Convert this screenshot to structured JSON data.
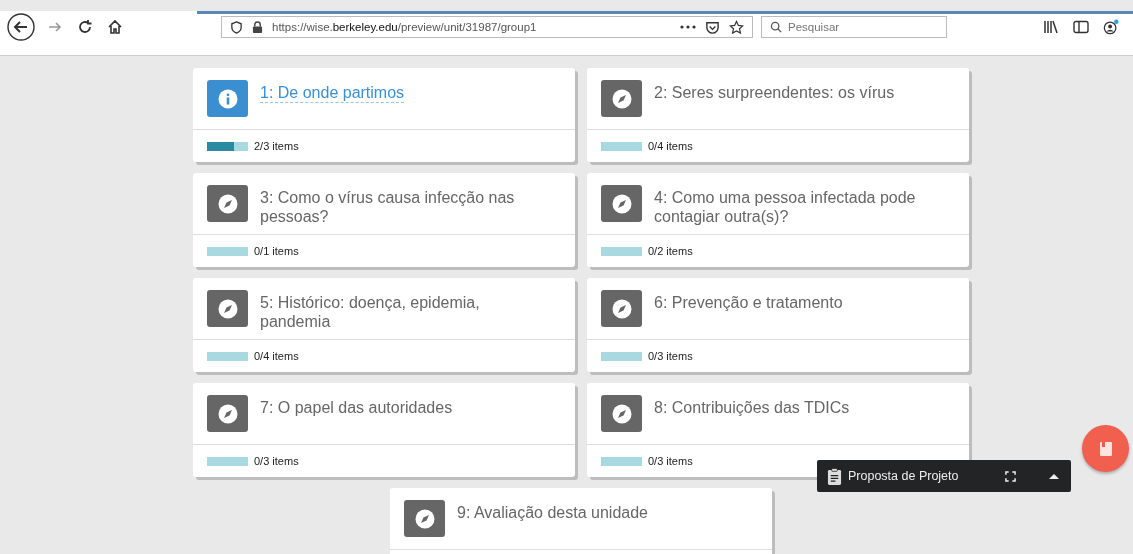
{
  "browser": {
    "url_prefix": "https://wise.",
    "url_host": "berkeley.edu",
    "url_path": "/preview/unit/31987/group1",
    "search_placeholder": "Pesquisar"
  },
  "lessons": [
    {
      "title": "1: De onde partimos",
      "kind": "info",
      "selected": true,
      "level": 0.667,
      "progress": "2/3 items"
    },
    {
      "title": "2: Seres surpreendentes: os vírus",
      "kind": "activity",
      "selected": false,
      "level": 0,
      "progress": "0/4 items"
    },
    {
      "title": "3: Como o vírus causa infecção nas pessoas?",
      "kind": "activity",
      "selected": false,
      "level": 0,
      "progress": "0/1 items"
    },
    {
      "title": "4: Como uma pessoa infectada pode contagiar outra(s)?",
      "kind": "activity",
      "selected": false,
      "level": 0,
      "progress": "0/2 items"
    },
    {
      "title": "5: Histórico: doença, epidemia, pandemia",
      "kind": "activity",
      "selected": false,
      "level": 0,
      "progress": "0/4 items"
    },
    {
      "title": "6: Prevenção e tratamento",
      "kind": "activity",
      "selected": false,
      "level": 0,
      "progress": "0/3 items"
    },
    {
      "title": "7: O papel das autoridades",
      "kind": "activity",
      "selected": false,
      "level": 0,
      "progress": "0/3 items"
    },
    {
      "title": "8: Contribuições das TDICs",
      "kind": "activity",
      "selected": false,
      "level": 0,
      "progress": "0/3 items"
    },
    {
      "title": "9: Avaliação desta unidade",
      "kind": "activity",
      "selected": false
    }
  ],
  "notebook_bar": {
    "title": "Proposta de Projeto"
  }
}
